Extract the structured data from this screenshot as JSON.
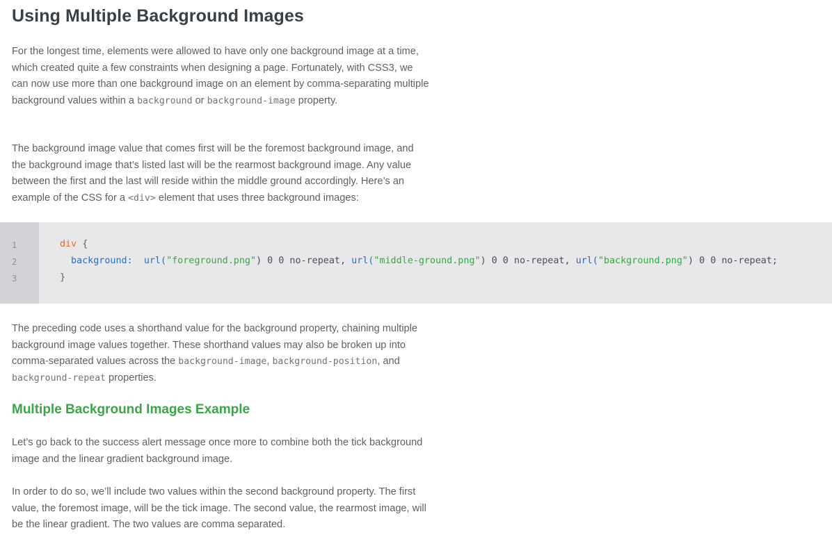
{
  "article": {
    "title": "Using Multiple Background Images",
    "para1": {
      "t1": "For the longest time, elements were allowed to have only one background image at a time, which created quite a few constraints when designing a page. Fortunately, with CSS3, we can now use more than one background image on an element by comma-separating multiple background values within a ",
      "c1": "background",
      "t2": " or ",
      "c2": "background-image",
      "t3": " property."
    },
    "para2": {
      "t1": "The background image value that comes first will be the foremost background image, and the background image that’s listed last will be the rearmost background image. Any value between the first and the last will reside within the middle ground accordingly. Here’s an example of the CSS for a ",
      "c1": "<div>",
      "t2": " element that uses three background images:"
    },
    "code": {
      "line_numbers": [
        "1",
        "2",
        "3"
      ],
      "selector": "div",
      "open_brace": " {",
      "property": "background:",
      "url1_fn": "url(",
      "url1_str": "\"foreground.png\"",
      "url1_rest": ") 0 0 no-repeat, ",
      "url2_fn": "url(",
      "url2_str": "\"middle-ground.png\"",
      "url2_rest": ") 0 0 no-repeat, ",
      "url3_fn": "url(",
      "url3_str": "\"background.png\"",
      "url3_rest": ") 0 0 no-repeat;",
      "close_brace": "}"
    },
    "para3": {
      "t1": "The preceding code uses a shorthand value for the background property, chaining multiple background image values together. These shorthand values may also be broken up into comma-separated values across the ",
      "c1": "background-image",
      "t2": ", ",
      "c2": "background-position",
      "t3": ", and ",
      "c3": "background-repeat",
      "t4": " properties."
    },
    "subheading": "Multiple Background Images Example",
    "para4": "Let’s go back to the success alert message once more to combine both the tick background image and the linear gradient background image.",
    "para5": "In order to do so, we’ll include two values within the second background property. The first value, the foremost image, will be the tick image. The second value, the rearmost image, will be the linear gradient. The two values are comma separated."
  },
  "colors": {
    "heading": "#3b4045",
    "subheading": "#3aa648",
    "code_selector": "#e66a2c",
    "code_property": "#2f6db5",
    "code_string": "#3aa648",
    "code_bg": "#e8e8ea",
    "gutter_bg": "#d2d3d6"
  }
}
